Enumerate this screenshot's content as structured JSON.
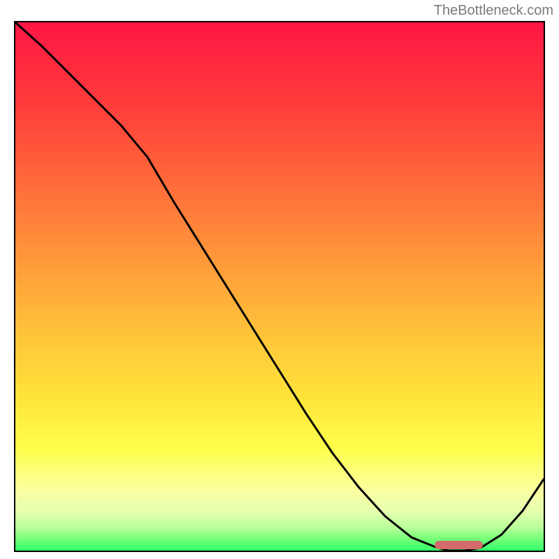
{
  "attribution": "TheBottleneck.com",
  "chart_data": {
    "type": "line",
    "title": "",
    "xlabel": "",
    "ylabel": "",
    "xlim": [
      0,
      100
    ],
    "ylim": [
      0,
      100
    ],
    "grid": false,
    "series": [
      {
        "name": "bottleneck-curve",
        "x": [
          0,
          5,
          10,
          15,
          20,
          25,
          30,
          35,
          40,
          45,
          50,
          55,
          60,
          65,
          70,
          75,
          80,
          82,
          85,
          88,
          92,
          96,
          100
        ],
        "y": [
          100,
          95.5,
          90.5,
          85.5,
          80.5,
          74.5,
          66.0,
          58.0,
          50.0,
          42.0,
          34.0,
          26.0,
          18.5,
          12.0,
          6.5,
          2.5,
          0.5,
          0.0,
          0.0,
          0.5,
          3.0,
          7.5,
          13.5
        ]
      }
    ],
    "optimal_range": {
      "start": 79,
      "end": 88,
      "y": 0
    },
    "gradient_stops": [
      {
        "pct": 0,
        "color": "#ff1744"
      },
      {
        "pct": 15,
        "color": "#ff3b3b"
      },
      {
        "pct": 30,
        "color": "#ff6a3a"
      },
      {
        "pct": 45,
        "color": "#ff9a3a"
      },
      {
        "pct": 58,
        "color": "#ffc23a"
      },
      {
        "pct": 70,
        "color": "#ffe23a"
      },
      {
        "pct": 80,
        "color": "#ffff4a"
      },
      {
        "pct": 88,
        "color": "#faffa0"
      },
      {
        "pct": 92,
        "color": "#e6ffb0"
      },
      {
        "pct": 95,
        "color": "#b8ff9a"
      },
      {
        "pct": 97,
        "color": "#7aff7a"
      },
      {
        "pct": 99,
        "color": "#3cff6a"
      },
      {
        "pct": 100,
        "color": "#18e65a"
      }
    ]
  }
}
